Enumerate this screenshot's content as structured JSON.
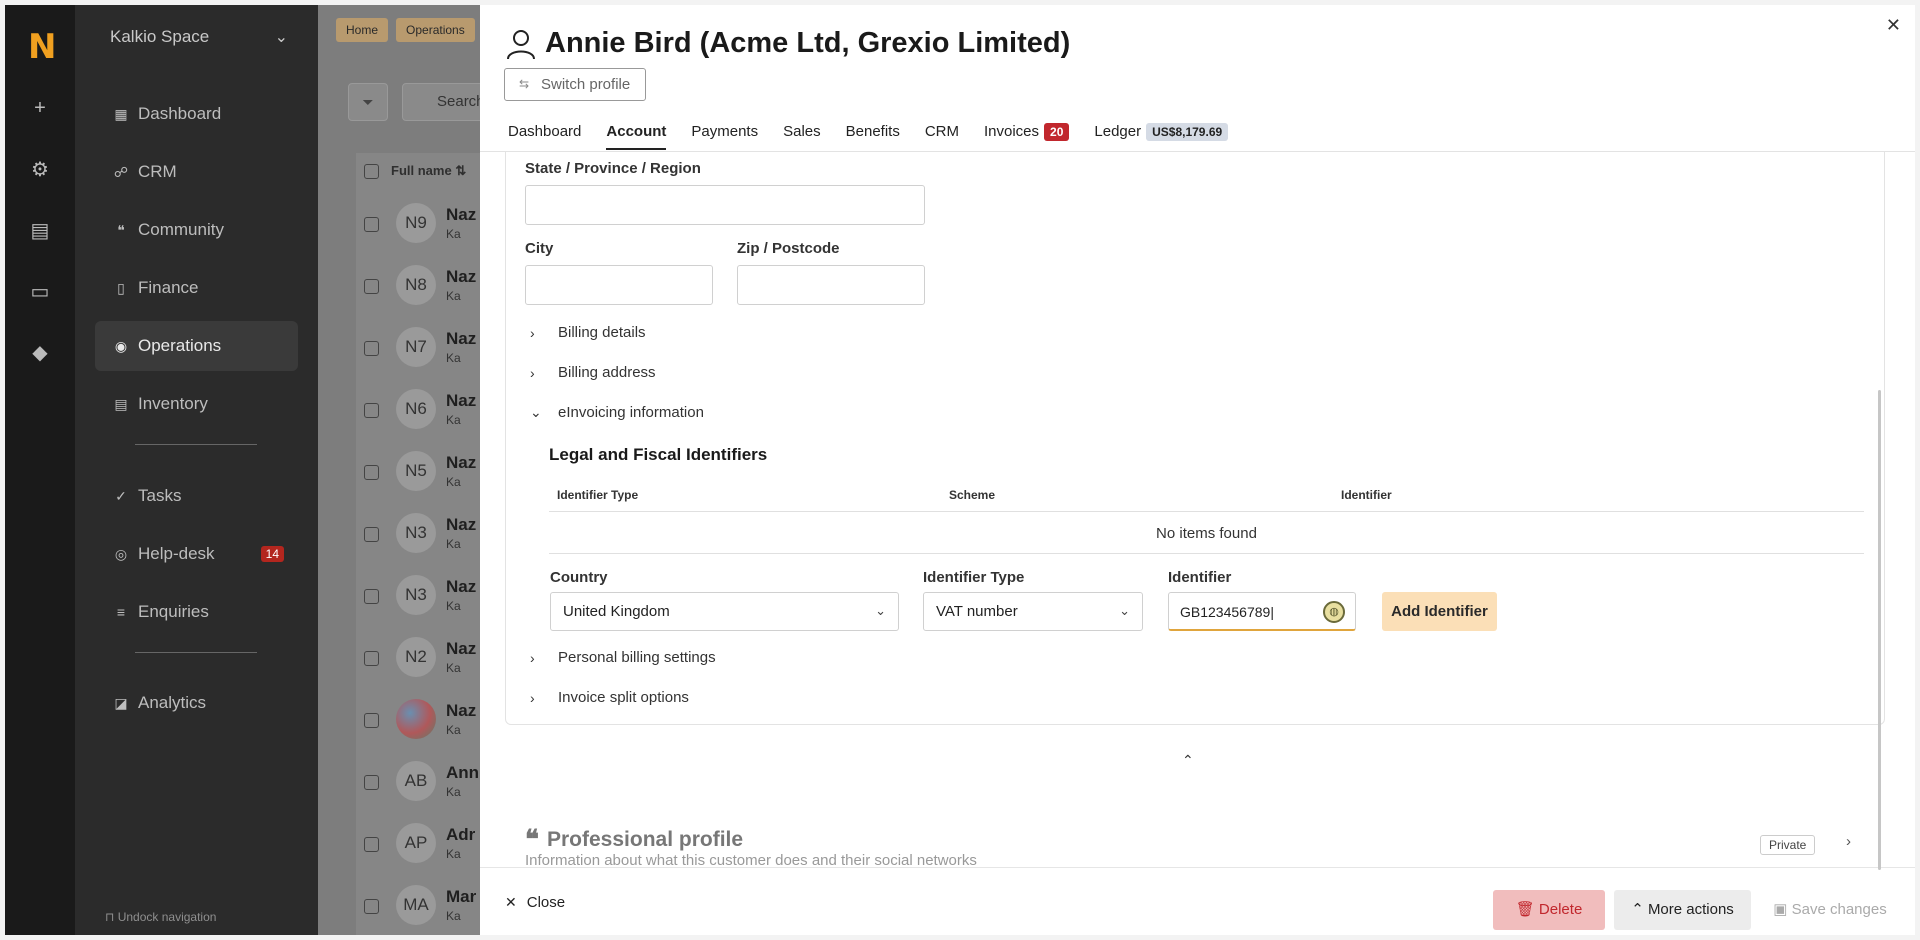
{
  "rail": {
    "logo": "N",
    "icons": [
      "plus-icon",
      "gear-icon",
      "folder-icon",
      "chat-icon",
      "graduation-cap-icon"
    ]
  },
  "nav": {
    "space": "Kalkio Space",
    "items": [
      {
        "label": "Dashboard",
        "icon": "dashboard-icon"
      },
      {
        "label": "CRM",
        "icon": "crm-icon"
      },
      {
        "label": "Community",
        "icon": "quote-icon"
      },
      {
        "label": "Finance",
        "icon": "document-icon"
      },
      {
        "label": "Operations",
        "icon": "operations-icon"
      },
      {
        "label": "Inventory",
        "icon": "inventory-icon"
      },
      {
        "label": "Tasks",
        "icon": "check-icon"
      },
      {
        "label": "Help-desk",
        "icon": "lifebuoy-icon",
        "badge": "14"
      },
      {
        "label": "Enquiries",
        "icon": "list-icon"
      },
      {
        "label": "Analytics",
        "icon": "chart-icon"
      }
    ],
    "undock": "Undock navigation"
  },
  "background": {
    "breadcrumbs": [
      "Home",
      "Operations"
    ],
    "search_placeholder": "Search",
    "column_header": "Full name",
    "rows": [
      {
        "initials": "N9",
        "name": "Naz",
        "sub": "Ka"
      },
      {
        "initials": "N8",
        "name": "Naz",
        "sub": "Ka"
      },
      {
        "initials": "N7",
        "name": "Naz",
        "sub": "Ka"
      },
      {
        "initials": "N6",
        "name": "Naz",
        "sub": "Ka"
      },
      {
        "initials": "N5",
        "name": "Naz",
        "sub": "Ka"
      },
      {
        "initials": "N3",
        "name": "Naz",
        "sub": "Ka"
      },
      {
        "initials": "N3",
        "name": "Naz",
        "sub": "Ka"
      },
      {
        "initials": "N2",
        "name": "Naz",
        "sub": "Ka"
      },
      {
        "initials": "",
        "name": "Naz",
        "sub": "Ka"
      },
      {
        "initials": "AB",
        "name": "Ann",
        "sub": "Ka"
      },
      {
        "initials": "AP",
        "name": "Adr",
        "sub": "Ka"
      },
      {
        "initials": "MA",
        "name": "Mar",
        "sub": "Ka"
      }
    ]
  },
  "drawer": {
    "title": "Annie Bird (Acme Ltd, Grexio Limited)",
    "switch_profile": "Switch profile",
    "tabs": [
      {
        "label": "Dashboard"
      },
      {
        "label": "Account",
        "active": true
      },
      {
        "label": "Payments"
      },
      {
        "label": "Sales"
      },
      {
        "label": "Benefits"
      },
      {
        "label": "CRM"
      },
      {
        "label": "Invoices",
        "badge": "20"
      },
      {
        "label": "Ledger",
        "amount": "US$8,179.69"
      }
    ],
    "fields": {
      "state_label": "State / Province / Region",
      "city_label": "City",
      "zip_label": "Zip / Postcode"
    },
    "sections": {
      "billing_details": "Billing details",
      "billing_address": "Billing address",
      "einvoicing": "eInvoicing information",
      "personal_billing": "Personal billing settings",
      "invoice_split": "Invoice split options"
    },
    "identifiers": {
      "title": "Legal and Fiscal Identifiers",
      "col_type": "Identifier Type",
      "col_scheme": "Scheme",
      "col_identifier": "Identifier",
      "empty": "No items found",
      "country_label": "Country",
      "country_value": "United Kingdom",
      "type_label": "Identifier Type",
      "type_value": "VAT number",
      "identifier_label": "Identifier",
      "identifier_value": "GB123456789",
      "add_button": "Add Identifier"
    },
    "professional": {
      "title": "Professional profile",
      "description": "Information about what this customer does and their social networks",
      "badge": "Private"
    },
    "footer": {
      "close": "Close",
      "delete": "Delete",
      "more": "More actions",
      "save": "Save changes"
    }
  },
  "colors": {
    "accent": "#f0a020",
    "danger": "#c1272d",
    "add_button_bg": "#fbdfb7"
  }
}
